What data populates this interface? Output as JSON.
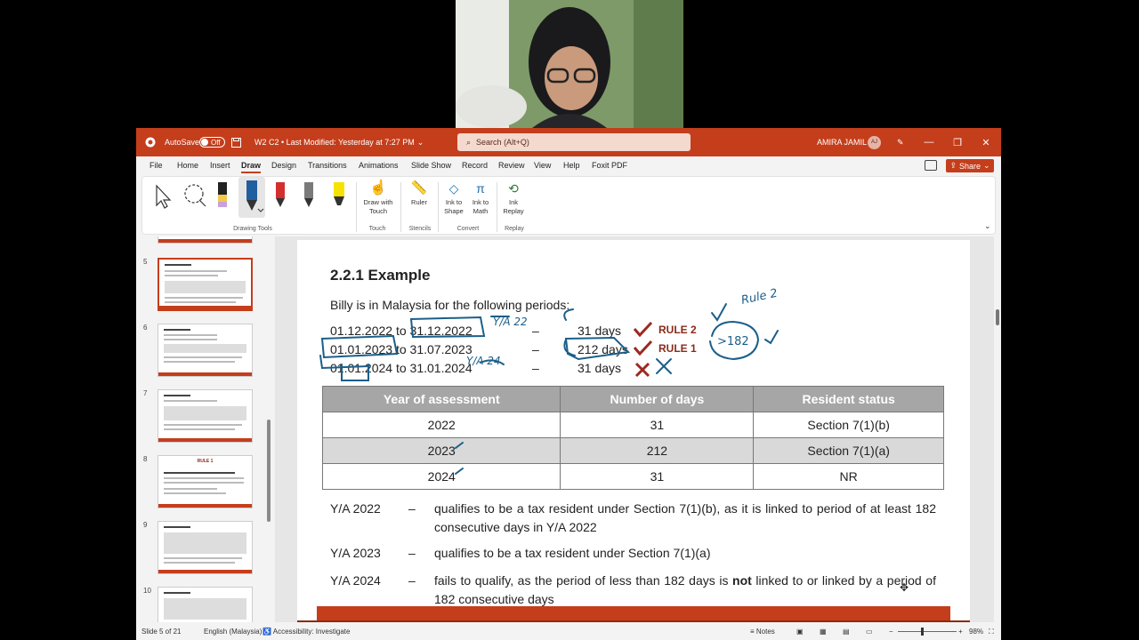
{
  "window": {
    "autosave_label": "AutoSave",
    "autosave_state": "Off",
    "file_title": "W2 C2 • Last Modified: Yesterday at 7:27 PM",
    "search_placeholder": "Search (Alt+Q)",
    "user_name": "AMIRA JAMIL",
    "user_initials": "AJ"
  },
  "menu": [
    "File",
    "Home",
    "Insert",
    "Draw",
    "Design",
    "Transitions",
    "Animations",
    "Slide Show",
    "Record",
    "Review",
    "View",
    "Help",
    "Foxit PDF"
  ],
  "active_menu": "Draw",
  "share_label": "Share",
  "ribbon": {
    "groups": {
      "drawing_tools": "Drawing Tools",
      "touch": "Touch",
      "stencils": "Stencils",
      "convert": "Convert",
      "replay": "Replay"
    },
    "buttons": {
      "draw_with_touch": "Draw with Touch",
      "ruler": "Ruler",
      "ink_to_shape": "Ink to Shape",
      "ink_to_math": "Ink to Math",
      "ink_replay": "Ink Replay"
    }
  },
  "thumbnails": {
    "numbers": [
      "5",
      "6",
      "7",
      "8",
      "9",
      "10"
    ],
    "rule_thumb_title": "RULE 1"
  },
  "slide": {
    "title": "2.2.1 Example",
    "intro": "Billy is in Malaysia for the following periods:",
    "periods": [
      {
        "from": "01.12.2022",
        "to": "31.12.2022",
        "dash": "–",
        "days": "31 days"
      },
      {
        "from": "01.01.2023",
        "to": "31.07.2023",
        "dash": "–",
        "days": "212 days"
      },
      {
        "from": "01.01.2024",
        "to": "31.01.2024",
        "dash": "–",
        "days": "31 days"
      }
    ],
    "connector": "to",
    "rule_labels": [
      "RULE 2",
      "RULE 1"
    ],
    "table": {
      "headers": [
        "Year of assessment",
        "Number of days",
        "Resident status"
      ],
      "rows": [
        [
          "2022",
          "31",
          "Section 7(1)(b)"
        ],
        [
          "2023",
          "212",
          "Section 7(1)(a)"
        ],
        [
          "2024",
          "31",
          "NR"
        ]
      ]
    },
    "explanations": [
      {
        "ya": "Y/A 2022",
        "dash": "–",
        "text": "qualifies to be a tax resident under Section 7(1)(b), as it is linked to period of at least 182 consecutive days in Y/A 2022"
      },
      {
        "ya": "Y/A 2023",
        "dash": "–",
        "text": "qualifies to be a tax resident under Section 7(1)(a)"
      },
      {
        "ya": "Y/A 2024",
        "dash": "–",
        "text_before": "fails to qualify, as the period of less than 182 days is ",
        "text_bold": "not",
        "text_after": " linked to or linked by a period of 182 consecutive days"
      }
    ]
  },
  "ink_annotations": {
    "ya22": "Y/A 22",
    "ya24": "Y/A 24",
    "rule2": "Rule 2",
    "gt182": ">182"
  },
  "status": {
    "slide_info": "Slide 5 of 21",
    "language": "English (Malaysia)",
    "accessibility": "Accessibility: Investigate",
    "notes": "Notes",
    "zoom": "98%"
  },
  "colors": {
    "accent": "#c43e1c",
    "ink_blue": "#1b5f8a",
    "check_red": "#9a2a20",
    "table_header": "#a6a6a6"
  }
}
